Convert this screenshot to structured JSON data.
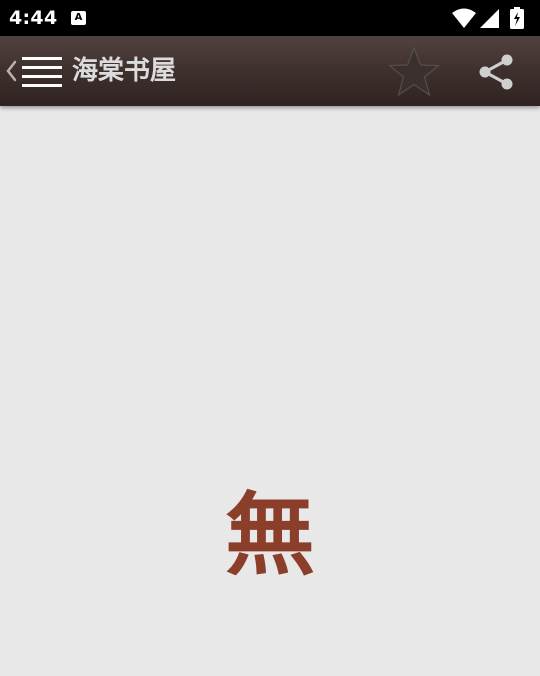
{
  "status_bar": {
    "time": "4:44",
    "notification_badge": "A",
    "icons": [
      "wifi-icon",
      "cell-signal-icon",
      "battery-charging-icon"
    ]
  },
  "toolbar": {
    "title": "海棠书屋",
    "icons": [
      "back-chevron-icon",
      "menu-icon",
      "star-icon",
      "share-icon"
    ],
    "colors": {
      "bar_top": "#52423f",
      "bar_bottom": "#2f2422",
      "title": "#dcdcdc"
    }
  },
  "content": {
    "empty_glyph": "無",
    "colors": {
      "background": "#e9e8e8",
      "glyph": "#8b3f2a"
    }
  }
}
